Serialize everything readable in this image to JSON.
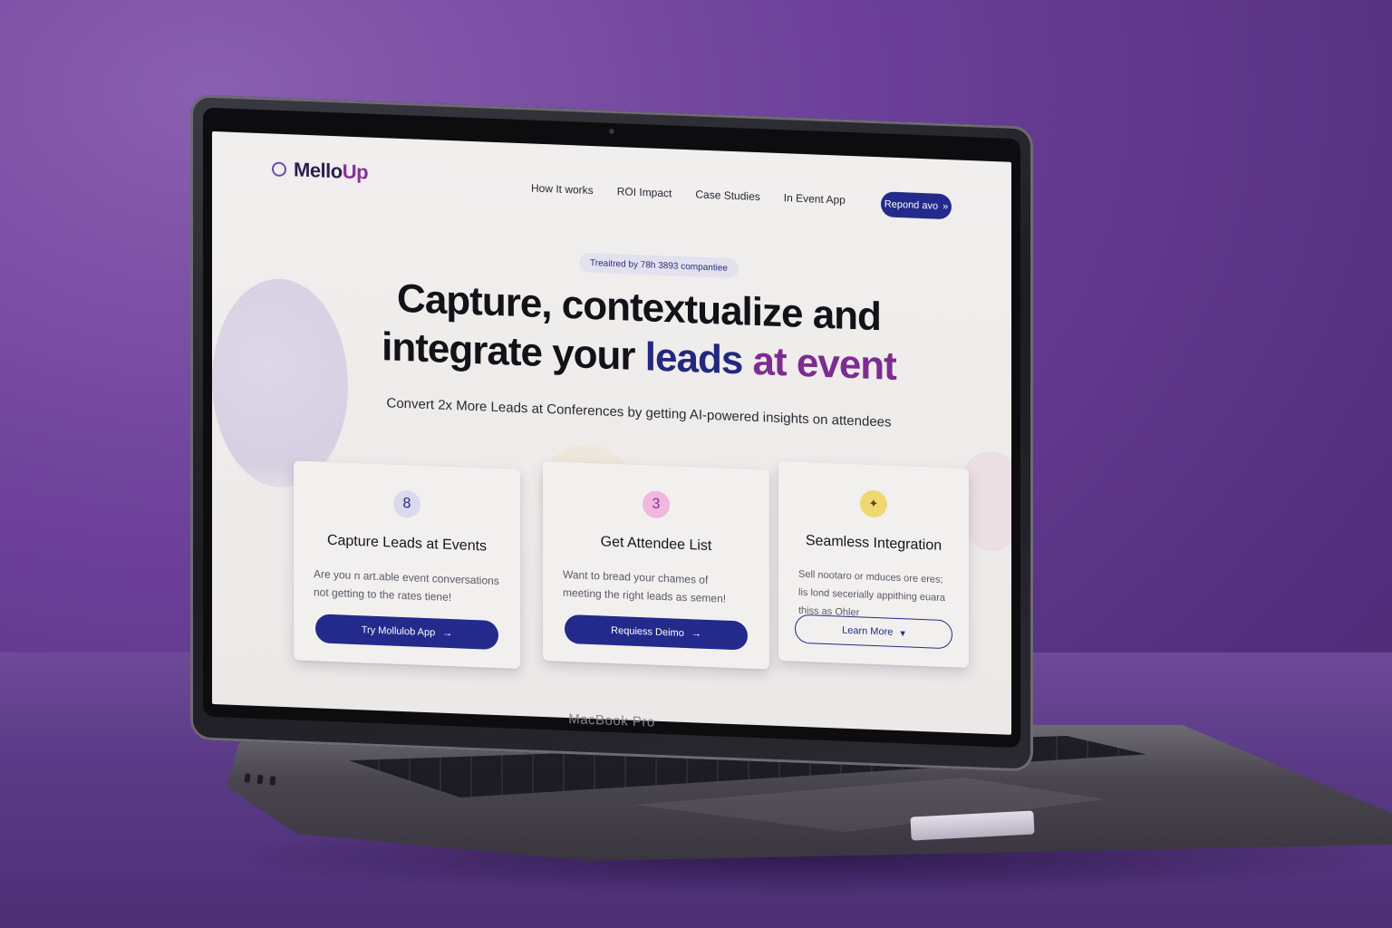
{
  "device": {
    "label": "MacBook Pro"
  },
  "app": {
    "logo": {
      "main": "Mello",
      "accent": "Up"
    },
    "nav": {
      "links": [
        "How It works",
        "ROI Impact",
        "Case Studies",
        "In Event App"
      ],
      "cta": {
        "label": "Repond avo",
        "icon": "double-chevron-right-icon"
      }
    },
    "hero": {
      "pill": "Treaitred by 78h 3893 compantiee",
      "headline_line1": "Capture, contextualize and",
      "headline_line2_prefix": "integrate your",
      "headline_highlight_a": "leads",
      "headline_highlight_b": "at event",
      "subheadline": "Convert 2x More Leads at Conferences by getting AI-powered insights on attendees"
    },
    "cards": [
      {
        "badge": "8",
        "title": "Capture Leads at Events",
        "body": "Are you n art.able event conversations not getting to the rates tiene!",
        "button": "Try Mollulob App",
        "button_icon": "arrow-right-icon"
      },
      {
        "badge": "3",
        "title": "Get Attendee List",
        "body": "Want to bread your chames of meeting the right leads as semen!",
        "button": "Requiess Deimo",
        "button_icon": "arrow-right-icon"
      },
      {
        "badge": "✦",
        "title": "Seamless Integration",
        "body": "Sell nootaro or mduces ore eres; lis lond secerially appithing euara thiss as Ohler",
        "button": "Learn More",
        "button_icon": "caret-down-icon"
      }
    ],
    "colors": {
      "primary": "#232a8c",
      "accent_purple": "#7d2c8f",
      "badge_1": "#dcd8ee",
      "badge_2": "#f0b8dc",
      "badge_3": "#f0d870"
    }
  }
}
